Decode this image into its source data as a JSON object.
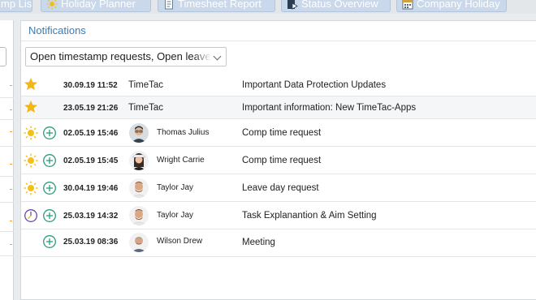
{
  "tabs": [
    {
      "label": "mp List",
      "icon": "list-icon"
    },
    {
      "label": "Holiday Planner",
      "icon": "sun-icon"
    },
    {
      "label": "Timesheet Report",
      "icon": "report-icon"
    },
    {
      "label": "Status Overview",
      "icon": "status-icon"
    },
    {
      "label": "Company Holiday",
      "icon": "calendar-icon"
    }
  ],
  "panel": {
    "title": "Notifications",
    "filter_value": "Open timestamp requests, Open leave requests"
  },
  "rows": [
    {
      "date": "30.09.19 11:52",
      "sender": "TimeTac",
      "subject": "Important Data Protection Updates",
      "status_icon": "star-icon",
      "add_icon": "",
      "avatar": "",
      "status_color": "#f3b619"
    },
    {
      "date": "23.05.19 21:26",
      "sender": "TimeTac",
      "subject": "Important information: New TimeTac-Apps",
      "status_icon": "star-icon",
      "add_icon": "",
      "avatar": "",
      "status_color": "#f3b619"
    },
    {
      "date": "02.05.19 15:46",
      "sender": "Thomas Julius",
      "subject": "Comp time request",
      "status_icon": "sun-icon",
      "add_icon": "plus-circle-icon",
      "avatar": "man-glasses",
      "status_color": "#f3c019"
    },
    {
      "date": "02.05.19 15:45",
      "sender": "Wright Carrie",
      "subject": "Comp time request",
      "status_icon": "sun-icon",
      "add_icon": "plus-circle-icon",
      "avatar": "woman-hat",
      "status_color": "#f3c019"
    },
    {
      "date": "30.04.19 19:46",
      "sender": "Taylor Jay",
      "subject": "Leave day request",
      "status_icon": "sun-icon",
      "add_icon": "plus-circle-icon",
      "avatar": "man-beard",
      "status_color": "#f3c019"
    },
    {
      "date": "25.03.19 14:32",
      "sender": "Taylor Jay",
      "subject": "Task Explanantion & Aim Setting",
      "status_icon": "clock-icon",
      "add_icon": "plus-circle-icon",
      "avatar": "man-beard",
      "status_color": "#6b4aa0"
    },
    {
      "date": "25.03.19 08:36",
      "sender": "Wilson Drew",
      "subject": "Meeting",
      "status_icon": "",
      "add_icon": "plus-circle-icon",
      "avatar": "man-bald",
      "status_color": ""
    }
  ],
  "colors": {
    "accent": "#3c7ab5",
    "tab_bg": "#c9d8ea",
    "plus_green": "#2a9d7c"
  }
}
